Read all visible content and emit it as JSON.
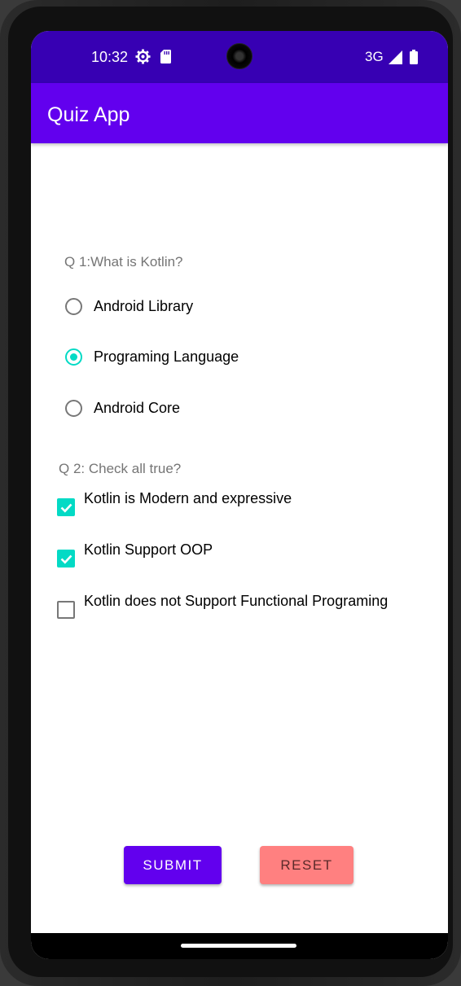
{
  "status_bar": {
    "time": "10:32",
    "network": "3G",
    "icons": [
      "gear-icon",
      "sd-card-icon",
      "signal-icon",
      "battery-icon"
    ]
  },
  "app_bar": {
    "title": "Quiz App",
    "color": "#6200ee"
  },
  "question1": {
    "text": "Q 1:What is Kotlin?",
    "options": [
      {
        "label": "Android Library",
        "selected": false
      },
      {
        "label": "Programing Language",
        "selected": true
      },
      {
        "label": "Android Core",
        "selected": false
      }
    ]
  },
  "question2": {
    "text": "Q 2: Check all true?",
    "options": [
      {
        "label": "Kotlin is Modern and expressive",
        "checked": true
      },
      {
        "label": "Kotlin Support OOP",
        "checked": true
      },
      {
        "label": "Kotlin does not Support Functional Programing",
        "checked": false
      }
    ]
  },
  "buttons": {
    "submit": "SUBMIT",
    "reset": "RESET"
  },
  "colors": {
    "accent": "#03dac5",
    "primary_dark": "#3700b3",
    "reset_bg": "#ff8080"
  }
}
